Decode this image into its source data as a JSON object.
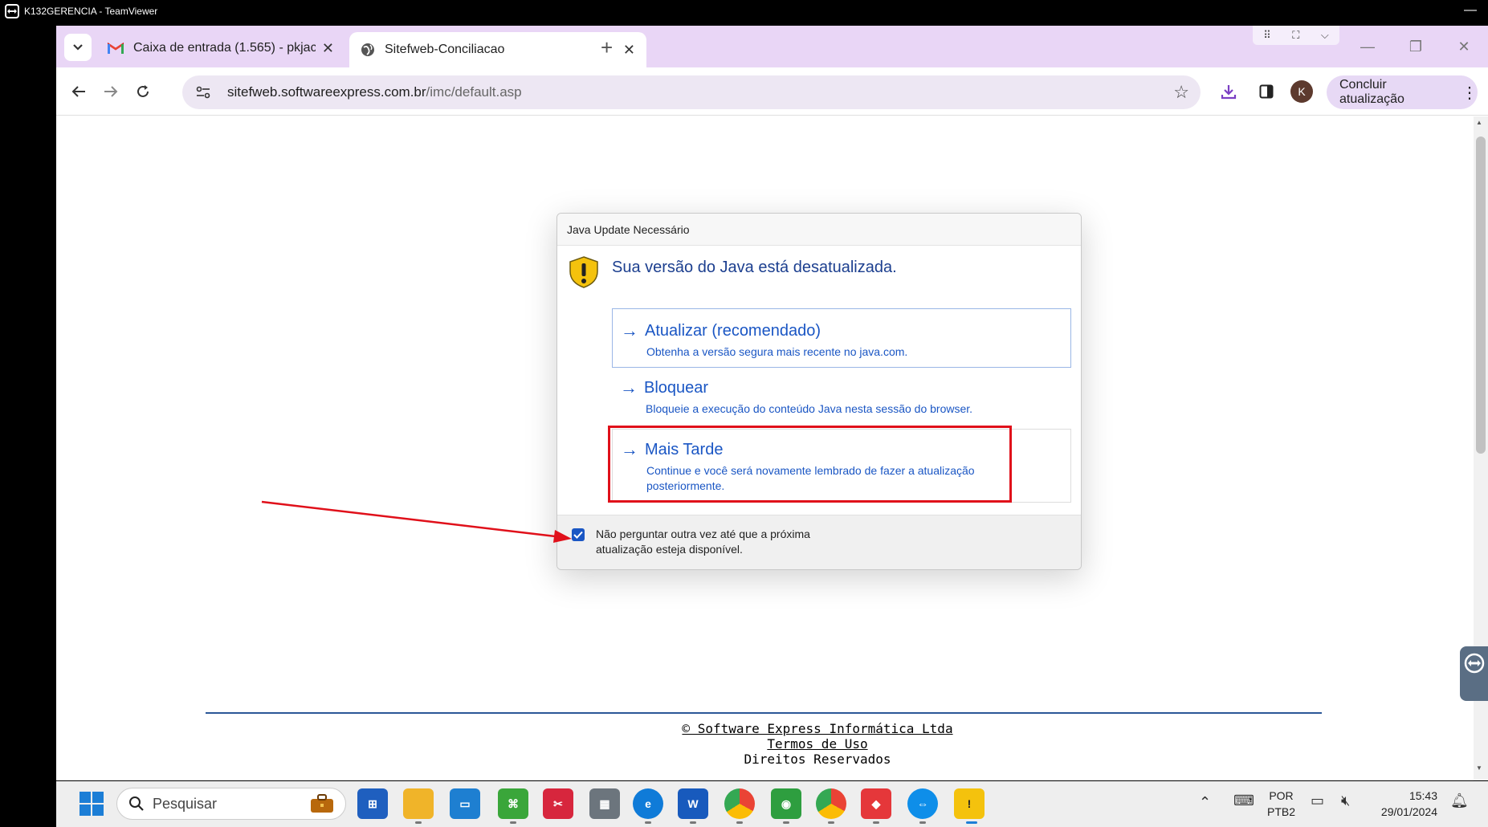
{
  "teamviewer": {
    "window_title": "K132GERENCIA - TeamViewer"
  },
  "browser": {
    "tabs": [
      {
        "title": "Caixa de entrada (1.565) - pkjac",
        "icon": "gmail-icon",
        "active": false
      },
      {
        "title": "Sitefweb-Conciliacao",
        "icon": "globe-icon",
        "active": true
      }
    ],
    "url_host": "sitefweb.softwareexpress.com.br",
    "url_path": "/imc/default.asp",
    "profile_initial": "K",
    "update_button_label": "Concluir atualização",
    "accent_color": "#e9d6f6"
  },
  "java_dialog": {
    "title": "Java Update Necessário",
    "heading": "Sua versão do Java está desatualizada.",
    "options": [
      {
        "title": "Atualizar (recomendado)",
        "desc": "Obtenha a versão segura mais recente no java.com."
      },
      {
        "title": "Bloquear",
        "desc": "Bloqueie a execução do conteúdo Java nesta sessão do browser."
      },
      {
        "title": "Mais Tarde",
        "desc": "Continue e você será novamente lembrado de fazer a atualização posteriormente."
      }
    ],
    "checkbox_label": "Não perguntar outra vez até que a próxima atualização esteja disponível.",
    "checkbox_checked": true,
    "link_color": "#1a56c4",
    "highlight_color": "#e0101a"
  },
  "footer": {
    "copyright": "© Software Express Informática Ltda",
    "terms": "Termos de Uso",
    "rights": "Direitos Reservados"
  },
  "taskbar": {
    "search_placeholder": "Pesquisar",
    "apps": [
      "file-explorer",
      "outlook",
      "edge",
      "word",
      "chrome",
      "teamviewer",
      "java"
    ],
    "language_line1": "POR",
    "language_line2": "PTB2",
    "time": "15:43",
    "date": "29/01/2024"
  }
}
